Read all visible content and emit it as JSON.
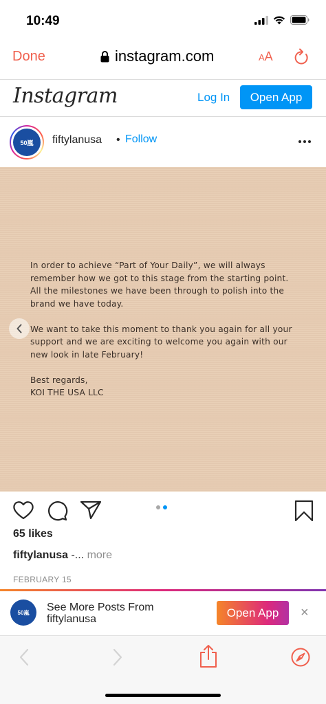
{
  "status_bar": {
    "time": "10:49",
    "icons": [
      "signal-icon",
      "wifi-icon",
      "battery-icon"
    ]
  },
  "safari": {
    "done_label": "Done",
    "url": "instagram.com",
    "text_size_label_small": "A",
    "text_size_label_large": "A",
    "accent_color": "#f0604e"
  },
  "ig_header": {
    "logo": "Instagram",
    "login_label": "Log In",
    "open_app_label": "Open App",
    "accent_color": "#0095f6"
  },
  "post": {
    "avatar_text": "50嵐",
    "username": "fiftylanusa",
    "separator": "•",
    "follow_label": "Follow",
    "image_text": {
      "paragraph1": "In order to achieve “Part of Your Daily”, we will always remember how we got to this stage from the starting point. All the milestones we have been through to polish into the brand we have today.",
      "paragraph2": "We want to take this moment to thank you again for all your support and we are exciting to welcome you again with our new look in late February!",
      "closing_line1": "Best regards,",
      "closing_line2": "KOI THE USA LLC"
    },
    "carousel": {
      "total": 2,
      "active": 2
    },
    "likes": "65 likes",
    "caption_user": "fiftylanusa",
    "caption_text": " -... ",
    "caption_more": "more",
    "date": "FEBRUARY 15"
  },
  "promo": {
    "avatar_text": "50嵐",
    "line1": "See More Posts From",
    "line2": "fiftylanusa",
    "button_label": "Open App",
    "close_label": "×"
  }
}
